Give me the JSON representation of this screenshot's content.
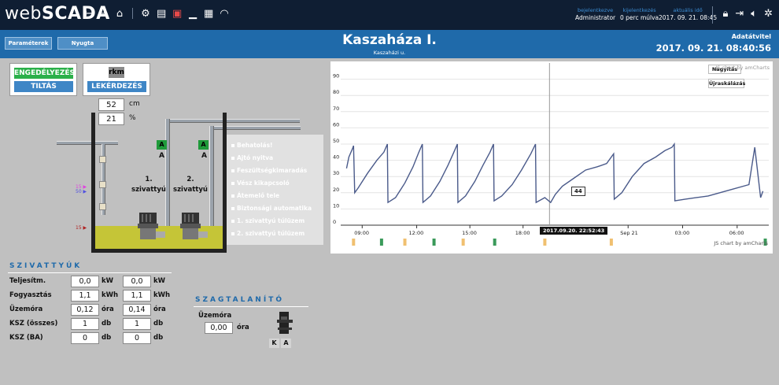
{
  "app": {
    "logo_prefix": "web",
    "logo_suffix": "SCADA"
  },
  "nav_icons": [
    "back-arrow-icon",
    "forward-arrow-icon",
    "home-icon",
    "settings-icon",
    "alarm-list-icon",
    "alarm-active-icon",
    "signal-icon",
    "grid-icon",
    "wifi-icon"
  ],
  "status": {
    "user_label": "bejelentkezve",
    "user_value": "Administrator",
    "logout_label": "kijelentkezés",
    "logout_value": "0 perc múlva",
    "time_label": "aktuális idő",
    "time_value": "2017. 09. 21. 08:45"
  },
  "right_icons": [
    "lock-icon",
    "logout-icon",
    "sound-icon",
    "settings-icon"
  ],
  "header": {
    "tabs": [
      "Paraméterek",
      "Nyugta"
    ],
    "title": "Kaszaháza I.",
    "subtitle": "Kaszaházi u.",
    "transfer_label": "Adatátvitel",
    "transfer_value": "2017. 09. 21. 08:40:56"
  },
  "control": {
    "enable_label": "ENGEDÉLYEZÉS",
    "disable_label": "TILTÁS",
    "rkm_label": "rkm",
    "query_label": "LEKÉRDEZÉS",
    "level_cm": "52",
    "level_cm_unit": "cm",
    "level_pct": "21",
    "level_pct_unit": "%"
  },
  "tank": {
    "pump1_label": "1. szivattyú",
    "pump2_label": "2. szivattyú",
    "pump1_mode_active": "A",
    "pump1_mode": "A",
    "pump2_mode_active": "A",
    "pump2_mode": "A",
    "level_markers": [
      {
        "value": "15",
        "color": "#e040e0"
      },
      {
        "value": "50",
        "color": "#5050e0"
      },
      {
        "value": "15",
        "color": "#b02020"
      }
    ]
  },
  "alarms": [
    "Behatolás!",
    "Ajtó nyitva",
    "Feszültségkimaradás",
    "Vész kikapcsoló",
    "Átemelő tele",
    "Biztonsági automatika",
    "1. szivattyú túlüzem",
    "2. szivattyú túlüzem"
  ],
  "chart_data": {
    "type": "line",
    "y_ticks": [
      "90",
      "80",
      "70",
      "60",
      "50",
      "40",
      "30",
      "20",
      "10",
      "0"
    ],
    "ylim": [
      0,
      100
    ],
    "x_ticks": [
      "09:00",
      "12:00",
      "15:00",
      "18:00",
      "Sep 21",
      "03:00",
      "06:00"
    ],
    "cursor_label": "2017.09.20. 22:52:43",
    "tooltip_value": "44",
    "zoom_button": "Nagyítás",
    "rescale_button": "Újraskálázás",
    "credit_top": "JS chart by amCharts",
    "credit_bottom": "JS chart by amCharts",
    "series": [
      {
        "color": "#4a5a8a",
        "x_hours": [
          0,
          0.2,
          0.5,
          0.6,
          0.7,
          1.0,
          1.8,
          2.6,
          3.2,
          3.5,
          3.55,
          4.2,
          5.0,
          5.7,
          6.2,
          6.5,
          6.55,
          7.2,
          8.0,
          8.7,
          9.2,
          9.5,
          9.55,
          10.2,
          11.0,
          11.7,
          12.3,
          12.6,
          12.65,
          13.3,
          14.2,
          15.0,
          15.8,
          16.2,
          16.25,
          17.0,
          17.5,
          17.9,
          18.5,
          19.5,
          20.5,
          21.5,
          22.3,
          22.9,
          22.95,
          23.6,
          24.5,
          25.5,
          26.5,
          27.3,
          27.9,
          28.1,
          28.15,
          29.0,
          30.0,
          31.0,
          32.0,
          33.0,
          34.5,
          35.0,
          35.5,
          35.7
        ],
        "y": [
          35,
          42,
          47,
          49,
          20,
          23,
          32,
          40,
          45,
          50,
          14,
          17,
          26,
          36,
          45,
          50,
          14,
          18,
          27,
          37,
          45,
          50,
          14,
          18,
          27,
          37,
          45,
          50,
          15,
          18,
          25,
          34,
          44,
          50,
          14,
          17,
          14,
          19,
          24,
          29,
          34,
          36,
          38,
          44,
          16,
          20,
          30,
          38,
          42,
          46,
          48,
          50,
          15,
          16,
          17,
          18,
          20,
          22,
          25,
          48,
          17,
          21
        ]
      }
    ],
    "markers": [
      {
        "x_hours": 0.6,
        "color": "#f0c070"
      },
      {
        "x_hours": 3.0,
        "color": "#3a9a5a"
      },
      {
        "x_hours": 5.0,
        "color": "#f0c070"
      },
      {
        "x_hours": 7.5,
        "color": "#3a9a5a"
      },
      {
        "x_hours": 10.0,
        "color": "#f0c070"
      },
      {
        "x_hours": 12.7,
        "color": "#3a9a5a"
      },
      {
        "x_hours": 17.0,
        "color": "#f0c070"
      },
      {
        "x_hours": 22.7,
        "color": "#f0c070"
      },
      {
        "x_hours": 35.9,
        "color": "#3a9a5a"
      }
    ]
  },
  "pumps": {
    "title": "SZIVATTYÚK",
    "rows": [
      {
        "label": "Teljesítm.",
        "v1": "0,0",
        "u1": "kW",
        "v2": "0,0",
        "u2": "kW"
      },
      {
        "label": "Fogyasztás",
        "v1": "1,1",
        "u1": "kWh",
        "v2": "1,1",
        "u2": "kWh"
      },
      {
        "label": "Üzemóra",
        "v1": "0,12",
        "u1": "óra",
        "v2": "0,14",
        "u2": "óra"
      },
      {
        "label": "KSZ (összes)",
        "v1": "1",
        "u1": "db",
        "v2": "1",
        "u2": "db"
      },
      {
        "label": "KSZ (BA)",
        "v1": "0",
        "u1": "db",
        "v2": "0",
        "u2": "db"
      }
    ]
  },
  "odor": {
    "title": "SZAGTALANÍTÓ",
    "hours_label": "Üzemóra",
    "hours_value": "0,00",
    "hours_unit": "óra",
    "mode_k": "K",
    "mode_a": "A"
  }
}
